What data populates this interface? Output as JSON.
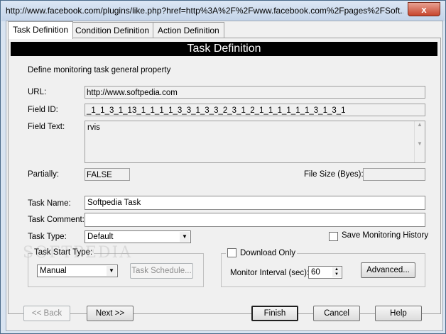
{
  "window": {
    "title": "http://www.facebook.com/plugins/like.php?href=http%3A%2F%2Fwww.facebook.com%2Fpages%2FSoft...",
    "close_glyph": "x"
  },
  "tabs": [
    {
      "label": "Task Definition",
      "active": true
    },
    {
      "label": "Condition Definition",
      "active": false
    },
    {
      "label": "Action Definition",
      "active": false
    }
  ],
  "panel": {
    "header": "Task Definition",
    "description": "Define monitoring task general property",
    "url_label": "URL:",
    "url_value": "http://www.softpedia.com",
    "field_id_label": "Field ID:",
    "field_id_value": "_1_1_3_1_13_1_1_1_1_3_3_1_3_3_2_3_1_2_1_1_1_1_1_1_3_1_3_1",
    "field_text_label": "Field Text:",
    "field_text_value": "rvis",
    "partially_label": "Partially:",
    "partially_value": "FALSE",
    "file_size_label": "File Size (Byes):",
    "file_size_value": "",
    "task_name_label": "Task Name:",
    "task_name_value": "Softpedia Task",
    "task_comment_label": "Task Comment:",
    "task_comment_value": "",
    "task_type_label": "Task Type:",
    "task_type_value": "Default",
    "save_history_label": "Save Monitoring History",
    "start_group_label": "Task Start Type:",
    "start_type_value": "Manual",
    "schedule_button": "Task Schedule...",
    "download_only_label": "Download Only",
    "monitor_interval_label": "Monitor Interval (sec):",
    "monitor_interval_value": "60",
    "advanced_button": "Advanced...",
    "watermark": "SOFTPEDIA"
  },
  "footer": {
    "back": "<< Back",
    "next": "Next >>",
    "finish": "Finish",
    "cancel": "Cancel",
    "help": "Help"
  }
}
